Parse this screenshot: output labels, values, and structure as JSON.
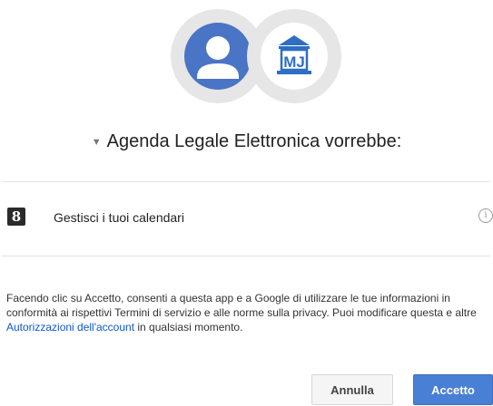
{
  "header": {
    "user_avatar_icon": "person-icon",
    "app_logo_icon": "courthouse-icon",
    "app_logo_text": "MJ"
  },
  "title": {
    "caret": "▼",
    "text": "Agenda Legale Elettronica vorrebbe:"
  },
  "permissions": [
    {
      "icon": "google-plus-icon",
      "icon_glyph": "8",
      "label": "Gestisci i tuoi calendari",
      "info_glyph": "i"
    }
  ],
  "consent": {
    "part1": "Facendo clic su Accetto, consenti a questa app e a Google di utilizzare le tue informazioni in conformità ai rispettivi Termini di servizio e alle norme sulla privacy. Puoi modificare questa e altre ",
    "link": "Autorizzazioni dell'account",
    "part2": " in qualsiasi momento."
  },
  "buttons": {
    "cancel": "Annulla",
    "accept": "Accetto"
  },
  "colors": {
    "accent": "#4a7fd6",
    "user_avatar": "#4a74c5",
    "logo": "#2e6fc2",
    "link": "#1155cc"
  }
}
